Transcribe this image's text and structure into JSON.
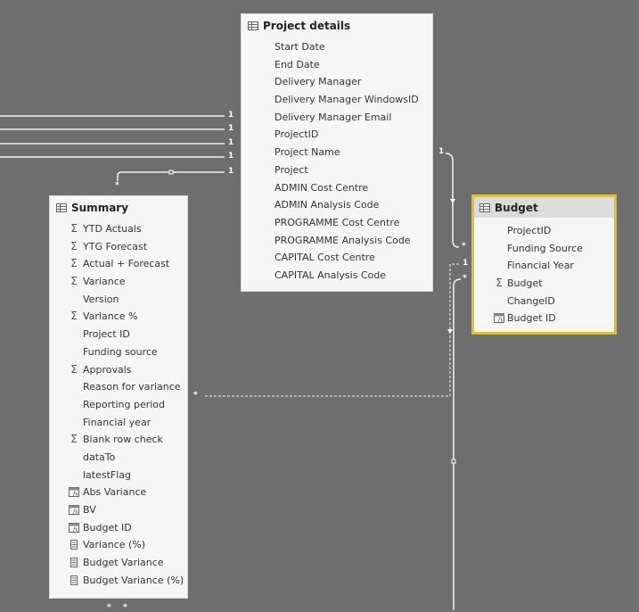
{
  "project_details": {
    "title": "Project details",
    "fields": [
      {
        "label": "Start Date",
        "icon": "none"
      },
      {
        "label": "End Date",
        "icon": "none"
      },
      {
        "label": "Delivery Manager",
        "icon": "none"
      },
      {
        "label": "Delivery Manager WindowsID",
        "icon": "none"
      },
      {
        "label": "Delivery Manager Email",
        "icon": "none"
      },
      {
        "label": "ProjectID",
        "icon": "none"
      },
      {
        "label": "Project Name",
        "icon": "none"
      },
      {
        "label": "Project",
        "icon": "none"
      },
      {
        "label": "ADMIN Cost Centre",
        "icon": "none"
      },
      {
        "label": "ADMIN Analysis Code",
        "icon": "none"
      },
      {
        "label": "PROGRAMME Cost Centre",
        "icon": "none"
      },
      {
        "label": "PROGRAMME Analysis Code",
        "icon": "none"
      },
      {
        "label": "CAPITAL Cost Centre",
        "icon": "none"
      },
      {
        "label": "CAPITAL Analysis Code",
        "icon": "none"
      }
    ]
  },
  "summary": {
    "title": "Summary",
    "fields": [
      {
        "label": "YTD Actuals",
        "icon": "sigma-icon"
      },
      {
        "label": "YTG Forecast",
        "icon": "sigma-icon"
      },
      {
        "label": "Actual + Forecast",
        "icon": "sigma-icon"
      },
      {
        "label": "Variance",
        "icon": "sigma-icon"
      },
      {
        "label": "Version",
        "icon": "none"
      },
      {
        "label": "Variance %",
        "icon": "sigma-icon"
      },
      {
        "label": "Project ID",
        "icon": "none"
      },
      {
        "label": "Funding source",
        "icon": "none"
      },
      {
        "label": "Approvals",
        "icon": "sigma-icon"
      },
      {
        "label": "Reason for variance",
        "icon": "none"
      },
      {
        "label": "Reporting period",
        "icon": "none"
      },
      {
        "label": "Financial year",
        "icon": "none"
      },
      {
        "label": "Blank row check",
        "icon": "sigma-icon"
      },
      {
        "label": "dataTo",
        "icon": "none"
      },
      {
        "label": "latestFlag",
        "icon": "none"
      },
      {
        "label": "Abs Variance",
        "icon": "calculated-column-icon"
      },
      {
        "label": "BV",
        "icon": "calculated-column-icon"
      },
      {
        "label": "Budget ID",
        "icon": "calculated-column-icon"
      },
      {
        "label": "Variance (%)",
        "icon": "measure-icon"
      },
      {
        "label": "Budget Variance",
        "icon": "measure-icon"
      },
      {
        "label": "Budget Variance (%)",
        "icon": "measure-icon"
      }
    ]
  },
  "budget": {
    "title": "Budget",
    "fields": [
      {
        "label": "ProjectID",
        "icon": "none"
      },
      {
        "label": "Funding Source",
        "icon": "none"
      },
      {
        "label": "Financial Year",
        "icon": "none"
      },
      {
        "label": "Budget",
        "icon": "sigma-icon"
      },
      {
        "label": "ChangeID",
        "icon": "none"
      },
      {
        "label": "Budget ID",
        "icon": "calculated-column-icon"
      }
    ]
  },
  "relationship_labels": {
    "one": "1",
    "many": "*"
  }
}
